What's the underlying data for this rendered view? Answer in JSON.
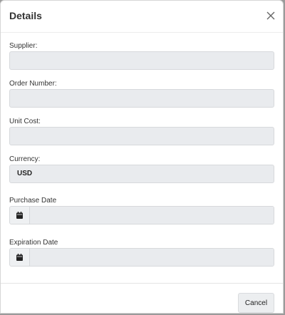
{
  "modal": {
    "title": "Details",
    "close_icon": "close-icon"
  },
  "fields": {
    "supplier": {
      "label": "Supplier:",
      "value": ""
    },
    "order_number": {
      "label": "Order Number:",
      "value": ""
    },
    "unit_cost": {
      "label": "Unit Cost:",
      "value": ""
    },
    "currency": {
      "label": "Currency:",
      "value": "USD"
    },
    "purchase_date": {
      "label": "Purchase Date",
      "value": "",
      "icon": "calendar-icon"
    },
    "expiration_date": {
      "label": "Expiration Date",
      "value": "",
      "icon": "calendar-icon"
    }
  },
  "footer": {
    "cancel_label": "Cancel"
  },
  "colors": {
    "input_bg": "#e9ebee",
    "input_border": "#d7d9dc",
    "text": "#333333"
  }
}
